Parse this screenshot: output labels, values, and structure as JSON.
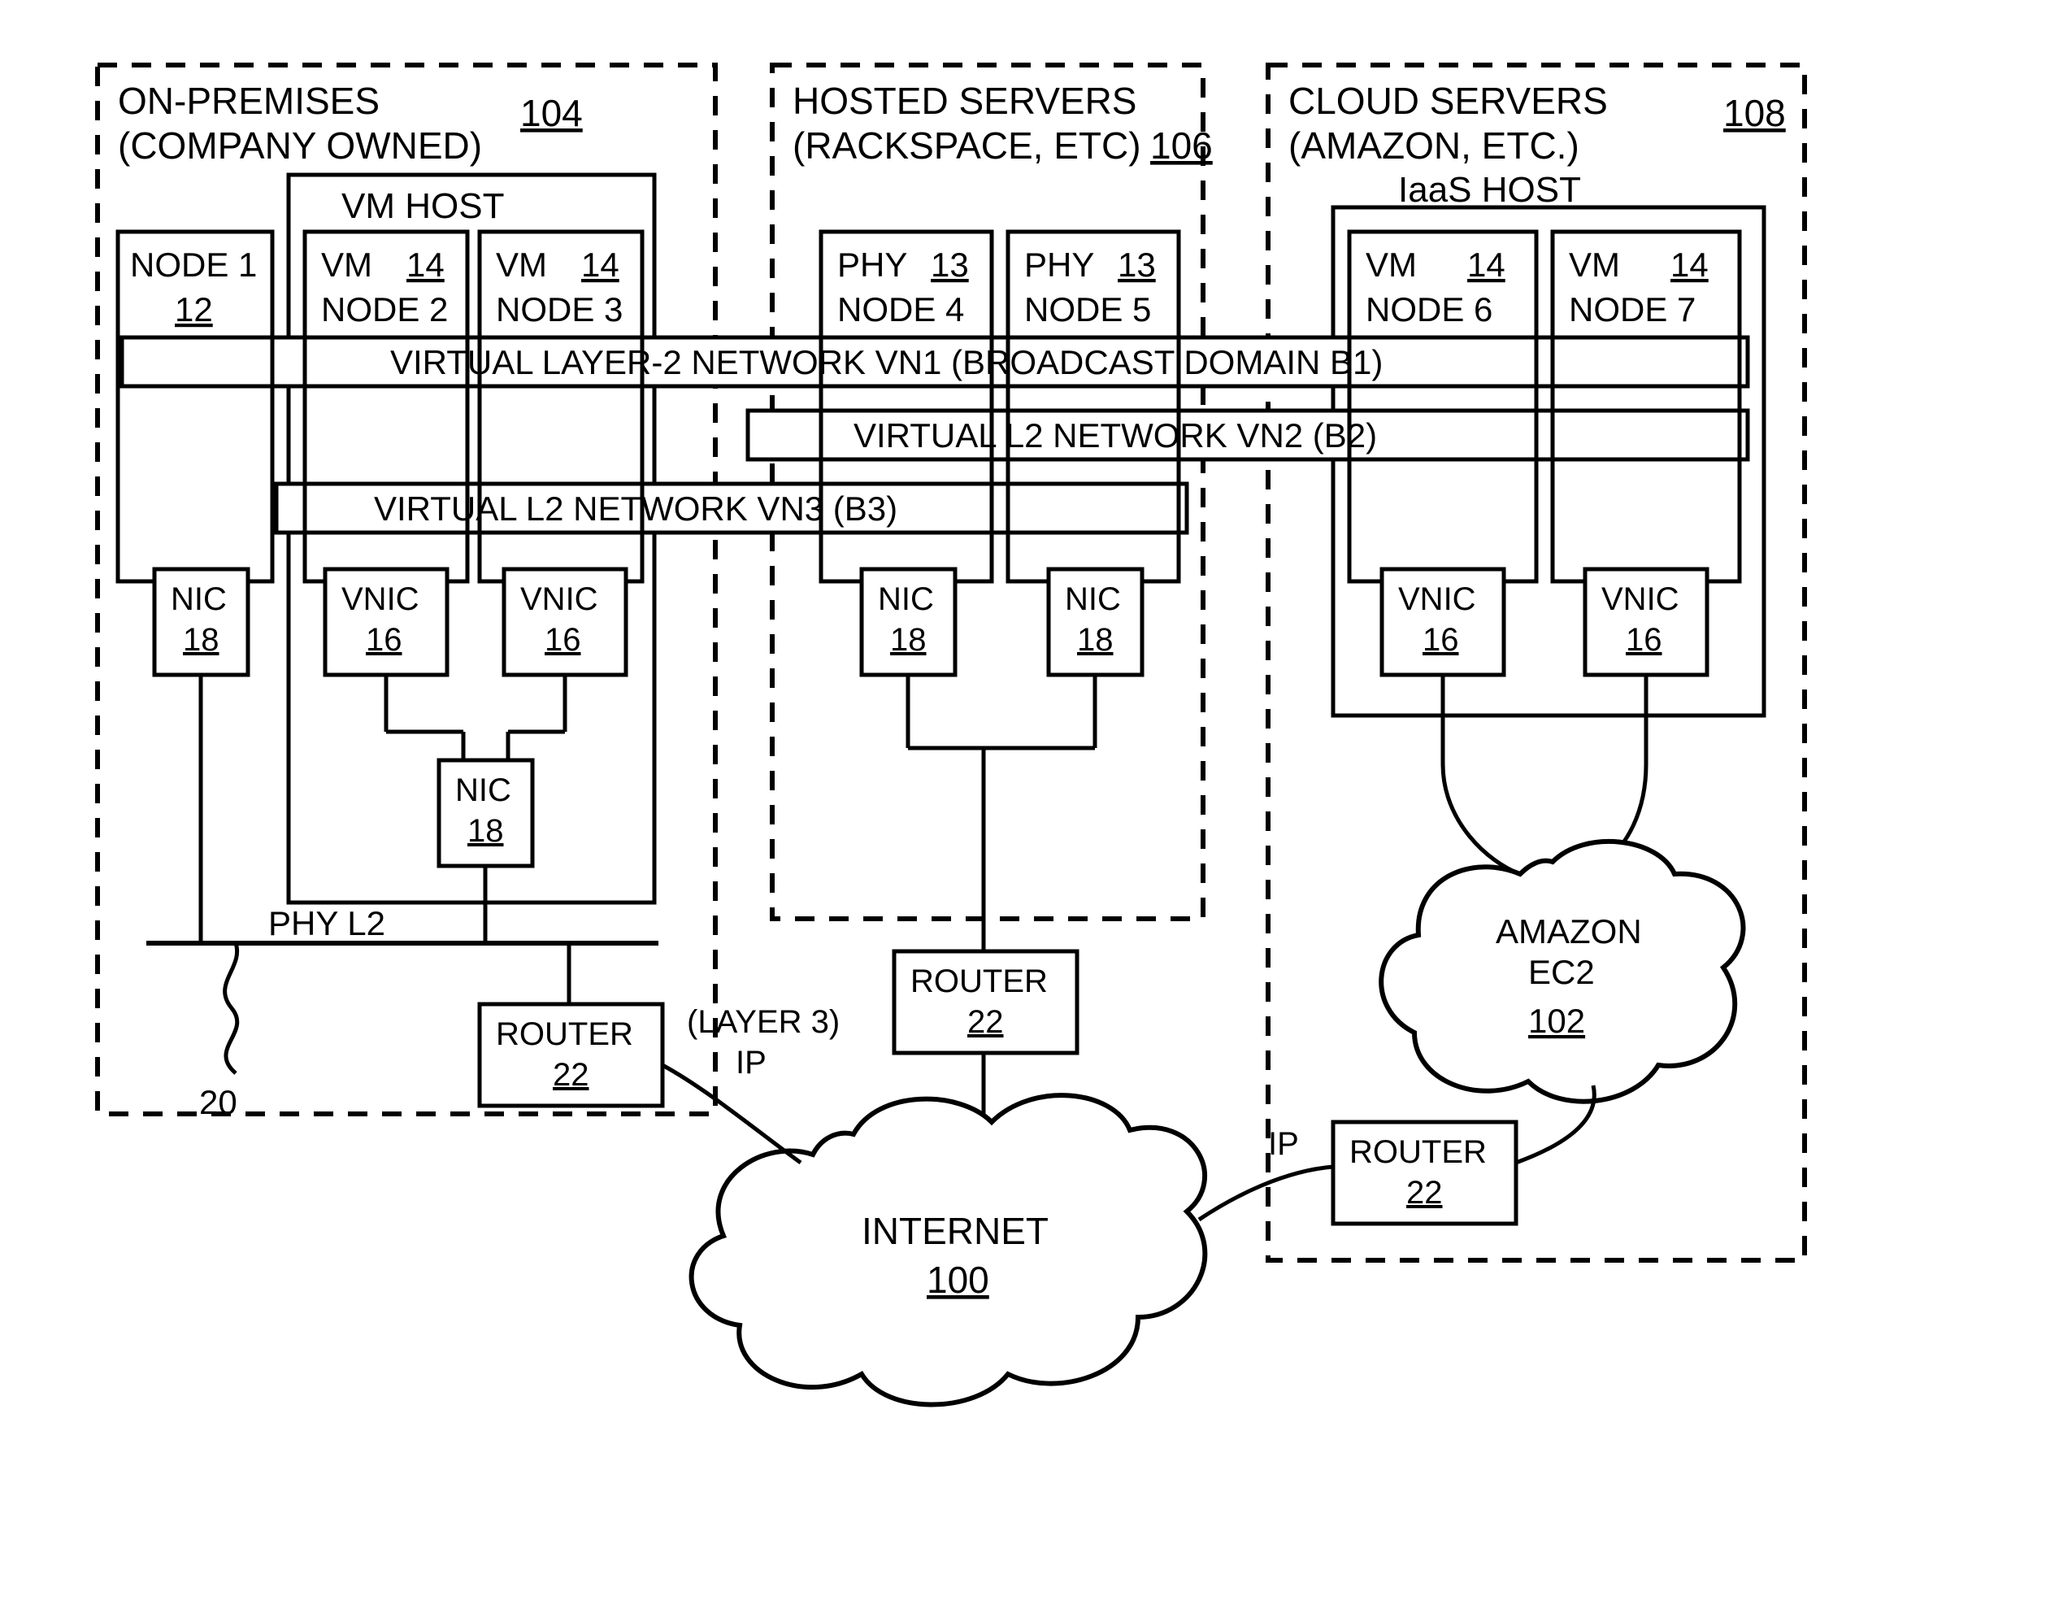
{
  "groups": {
    "onprem": {
      "title1": "ON-PREMISES",
      "title2": "(COMPANY OWNED)",
      "ref": "104"
    },
    "hosted": {
      "title1": "HOSTED SERVERS",
      "title2": "(RACKSPACE, ETC)",
      "ref": "106"
    },
    "cloud": {
      "title1": "CLOUD SERVERS",
      "title2": "(AMAZON, ETC.)",
      "ref": "108"
    }
  },
  "hosts": {
    "vmhost": "VM HOST",
    "iaashost": "IaaS HOST"
  },
  "nodes": {
    "n1": {
      "label1": "NODE 1",
      "ref": "12"
    },
    "n2": {
      "label1": "VM",
      "label2": "NODE 2",
      "ref": "14"
    },
    "n3": {
      "label1": "VM",
      "label2": "NODE 3",
      "ref": "14"
    },
    "n4": {
      "label1": "PHY",
      "label2": "NODE 4",
      "ref": "13"
    },
    "n5": {
      "label1": "PHY",
      "label2": "NODE 5",
      "ref": "13"
    },
    "n6": {
      "label1": "VM",
      "label2": "NODE 6",
      "ref": "14"
    },
    "n7": {
      "label1": "VM",
      "label2": "NODE 7",
      "ref": "14"
    }
  },
  "vn": {
    "vn1": "VIRTUAL LAYER-2 NETWORK  VN1 (BROADCAST DOMAIN B1)",
    "vn2": "VIRTUAL L2 NETWORK  VN2  (B2)",
    "vn3": "VIRTUAL L2 NETWORK  VN3  (B3)"
  },
  "nic": {
    "label": "NIC",
    "ref": "18"
  },
  "vnic": {
    "label": "VNIC",
    "ref": "16"
  },
  "router": {
    "label": "ROUTER",
    "ref": "22"
  },
  "phyL2": {
    "label": "PHY L2",
    "ref": "20"
  },
  "ipA": "(LAYER 3)",
  "ipB": "IP",
  "ipC": "IP",
  "clouds": {
    "ec2": {
      "label": "AMAZON",
      "label2": "EC2",
      "ref": "102"
    },
    "internet": {
      "label": "INTERNET",
      "ref": "100"
    }
  }
}
